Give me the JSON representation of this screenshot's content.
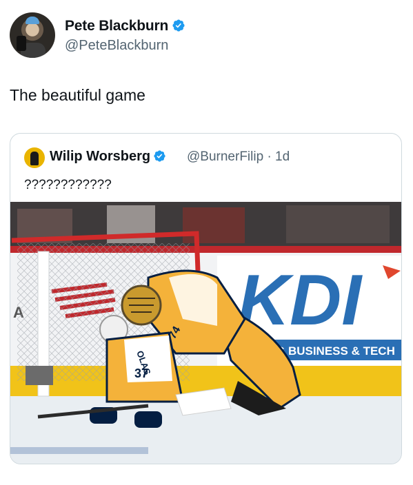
{
  "author": {
    "display_name": "Pete Blackburn",
    "handle": "@PeteBlackburn",
    "verified": true
  },
  "tweet": {
    "text": "The beautiful game"
  },
  "quoted_tweet": {
    "display_name": "Wilip Worsberg",
    "handle": "@BurnerFilip",
    "separator": "·",
    "age": "1d",
    "text": "????????????",
    "verified": true
  },
  "media": {
    "board_text_logo": "KDI",
    "board_text_tagline": "ING BUSINESS & TECH",
    "jersey_number_front": "37",
    "jersey_number_goalie": "74",
    "jersey_name": "OLAS"
  },
  "colors": {
    "verified_blue": "#1d9bf0",
    "secondary_text": "#536471",
    "predators_gold": "#f4b23a",
    "predators_navy": "#041e42",
    "board_blue": "#2a6fb5"
  }
}
